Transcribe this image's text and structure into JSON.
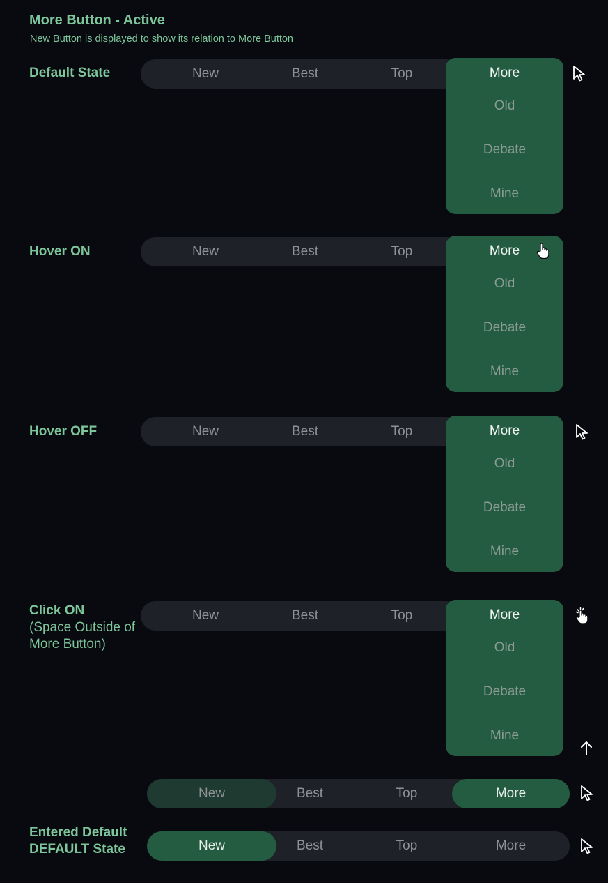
{
  "page": {
    "title": "More Button - Active",
    "subtitle": "New Button is displayed to show its relation to More Button"
  },
  "tabs": [
    "New",
    "Best",
    "Top",
    "More"
  ],
  "dropdown_options": [
    "Old",
    "Debate",
    "Mine"
  ],
  "states": [
    {
      "label": "Default State",
      "sublabel": "",
      "cursor": "arrow-cursor-icon"
    },
    {
      "label": "Hover ON",
      "sublabel": "",
      "cursor": "hand-pointer-icon"
    },
    {
      "label": "Hover OFF",
      "sublabel": "",
      "cursor": "arrow-cursor-icon"
    },
    {
      "label": "Click ON",
      "sublabel": "(Space Outside of More Button)",
      "cursor": "hand-click-icon"
    },
    {
      "label": "",
      "sublabel": "",
      "cursor": "arrow-cursor-icon"
    },
    {
      "label": "Entered Default DEFAULT State",
      "sublabel": "",
      "cursor": "arrow-cursor-icon"
    }
  ],
  "annotation_icon": "arrow-up-icon",
  "colors": {
    "background": "#080a0f",
    "bar": "#1f2128",
    "accent_green": "#245c41",
    "dim_green": "#1f3a30",
    "label_green": "#7dc59a",
    "tab_text": "#8e9196",
    "active_text": "#e6ece8"
  }
}
